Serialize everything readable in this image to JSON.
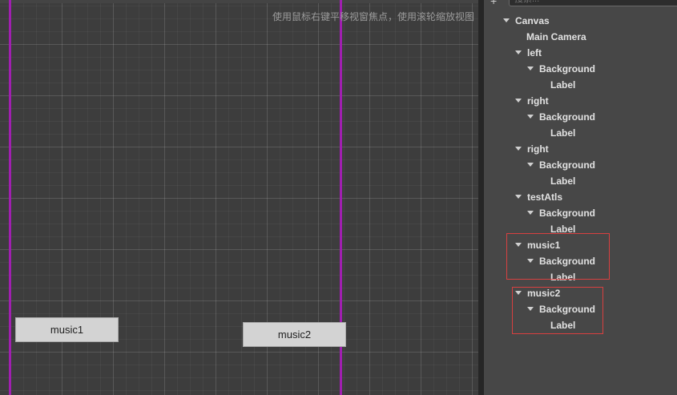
{
  "scene": {
    "hint": "使用鼠标右键平移视窗焦点，使用滚轮缩放视图",
    "buttons": [
      {
        "label": "music1"
      },
      {
        "label": "music2"
      }
    ]
  },
  "hierarchy": {
    "search_placeholder": "搜索...",
    "nodes": [
      {
        "label": "Canvas"
      },
      {
        "label": "Main Camera"
      },
      {
        "label": "left"
      },
      {
        "label": "Background"
      },
      {
        "label": "Label"
      },
      {
        "label": "right"
      },
      {
        "label": "Background"
      },
      {
        "label": "Label"
      },
      {
        "label": "right"
      },
      {
        "label": "Background"
      },
      {
        "label": "Label"
      },
      {
        "label": "testAtls"
      },
      {
        "label": "Background"
      },
      {
        "label": "Label"
      },
      {
        "label": "music1"
      },
      {
        "label": "Background"
      },
      {
        "label": "Label"
      },
      {
        "label": "music2"
      },
      {
        "label": "Background"
      },
      {
        "label": "Label"
      }
    ]
  },
  "colors": {
    "guide_line": "#a01fb0",
    "highlight_box": "#d84040"
  }
}
